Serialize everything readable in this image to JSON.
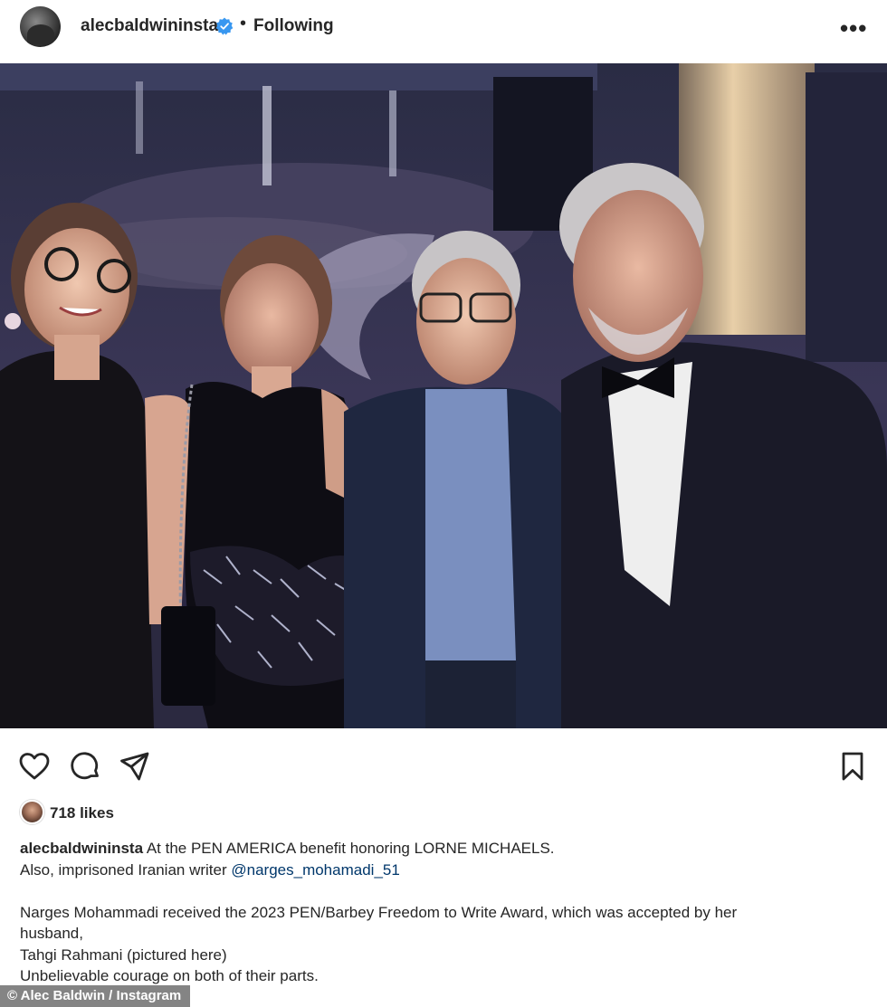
{
  "header": {
    "username": "alecbaldwininsta",
    "separator": "•",
    "follow_status": "Following",
    "more_label": "•••"
  },
  "photo": {
    "description_icon": "photo-image"
  },
  "actions": {
    "like_icon": "heart-icon",
    "comment_icon": "comment-icon",
    "share_icon": "send-icon",
    "save_icon": "bookmark-icon"
  },
  "likes": {
    "text": "718 likes"
  },
  "caption": {
    "username": "alecbaldwininsta",
    "line1_text": " At the PEN AMERICA benefit honoring LORNE MICHAELS.",
    "line2_text": "Also, imprisoned Iranian writer ",
    "line2_mention": "@narges_mohamadi_51",
    "line3": "Narges Mohammadi received the 2023 PEN/Barbey Freedom to Write Award, which was accepted by her",
    "line4": "husband,",
    "line5": "Tahgi Rahmani (pictured here)",
    "line6": "Unbelievable courage on both of their parts."
  },
  "credit": {
    "text": "© Alec Baldwin / Instagram"
  },
  "colors": {
    "verified_badge": "#3897f0",
    "mention": "#00376b",
    "text": "#262626"
  }
}
